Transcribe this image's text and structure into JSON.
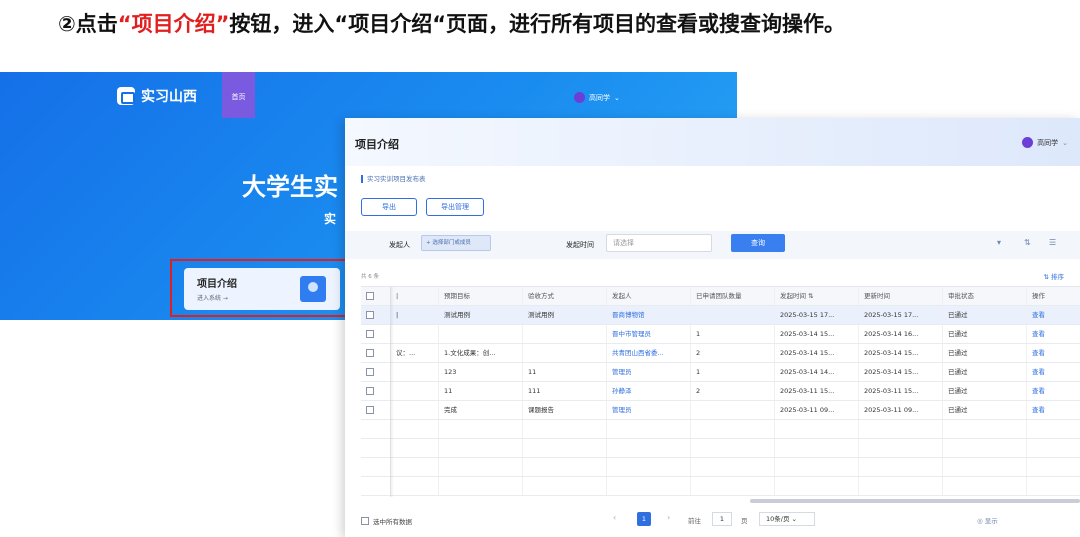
{
  "instruction": {
    "prefix": "②点击",
    "highlight": "“项目介绍”",
    "suffix": "按钮，进入“项目介绍“页面，进行所有项目的查看或搜查询操作。"
  },
  "home": {
    "logo_text": "实习山西",
    "nav_tab": "首页",
    "user_name": "高同学",
    "user_chevron": "⌄",
    "hero_title": "大学生实",
    "hero_sub": "实",
    "card_title": "项目介绍",
    "card_sub": "进入系统 →",
    "colors": {
      "banner": "#1a8cf0",
      "highlight_box": "#e02020",
      "nav_tab": "#7a5be0"
    }
  },
  "panel": {
    "page_title": "项目介绍",
    "user_name": "高同学",
    "user_chevron": "⌄",
    "section_title": "实习实训项目发布表",
    "buttons": {
      "export": "导出",
      "export_manage": "导出管理"
    },
    "filter": {
      "initiator_label": "发起人",
      "initiator_pick": "+ 选择部门或成员",
      "time_label": "发起时间",
      "time_placeholder": "请选择",
      "query_button": "查询",
      "collapse_icon": "▾",
      "columns_icon": "⇅",
      "settings_icon": "☰"
    },
    "count_text": "共 6 条",
    "sort_text": "⇅ 排序",
    "table": {
      "headers": [
        "",
        "|",
        "预期目标",
        "验收方式",
        "发起人",
        "已申请团队数量",
        "发起时间  ⇅",
        "更新时间",
        "审批状态",
        "操作"
      ],
      "rows": [
        [
          "",
          "|",
          "测试用例",
          "测试用例",
          "晋商博物馆",
          "",
          "2025-03-15 17...",
          "2025-03-15 17...",
          "已通过",
          "查看"
        ],
        [
          "",
          "",
          "",
          "",
          "晋中市管理员",
          "1",
          "2025-03-14 15...",
          "2025-03-14 16...",
          "已通过",
          "查看"
        ],
        [
          "",
          "议：...",
          "1.文化成果：创...",
          "",
          "共青团山西省委...",
          "2",
          "2025-03-14 15...",
          "2025-03-14 15...",
          "已通过",
          "查看"
        ],
        [
          "",
          "",
          "123",
          "11",
          "管理员",
          "1",
          "2025-03-14 14...",
          "2025-03-14 15...",
          "已通过",
          "查看"
        ],
        [
          "",
          "",
          "11",
          "111",
          "孙静泽",
          "2",
          "2025-03-11 15...",
          "2025-03-11 15...",
          "已通过",
          "查看"
        ],
        [
          "",
          "",
          "完成",
          "课题报告",
          "管理员",
          "",
          "2025-03-11 09...",
          "2025-03-11 09...",
          "已通过",
          "查看"
        ]
      ]
    },
    "footer": {
      "select_all": "选中所有数据",
      "prev": "‹",
      "current_page": "1",
      "next": "›",
      "goto_label": "前往",
      "page_input": "1",
      "page_unit": "页",
      "page_size": "10条/页  ⌄",
      "show": "◎ 显示"
    },
    "colors": {
      "primary": "#2f6fe0",
      "query_button": "#3a7ff0",
      "filter_bg": "#f3f6fb"
    }
  }
}
